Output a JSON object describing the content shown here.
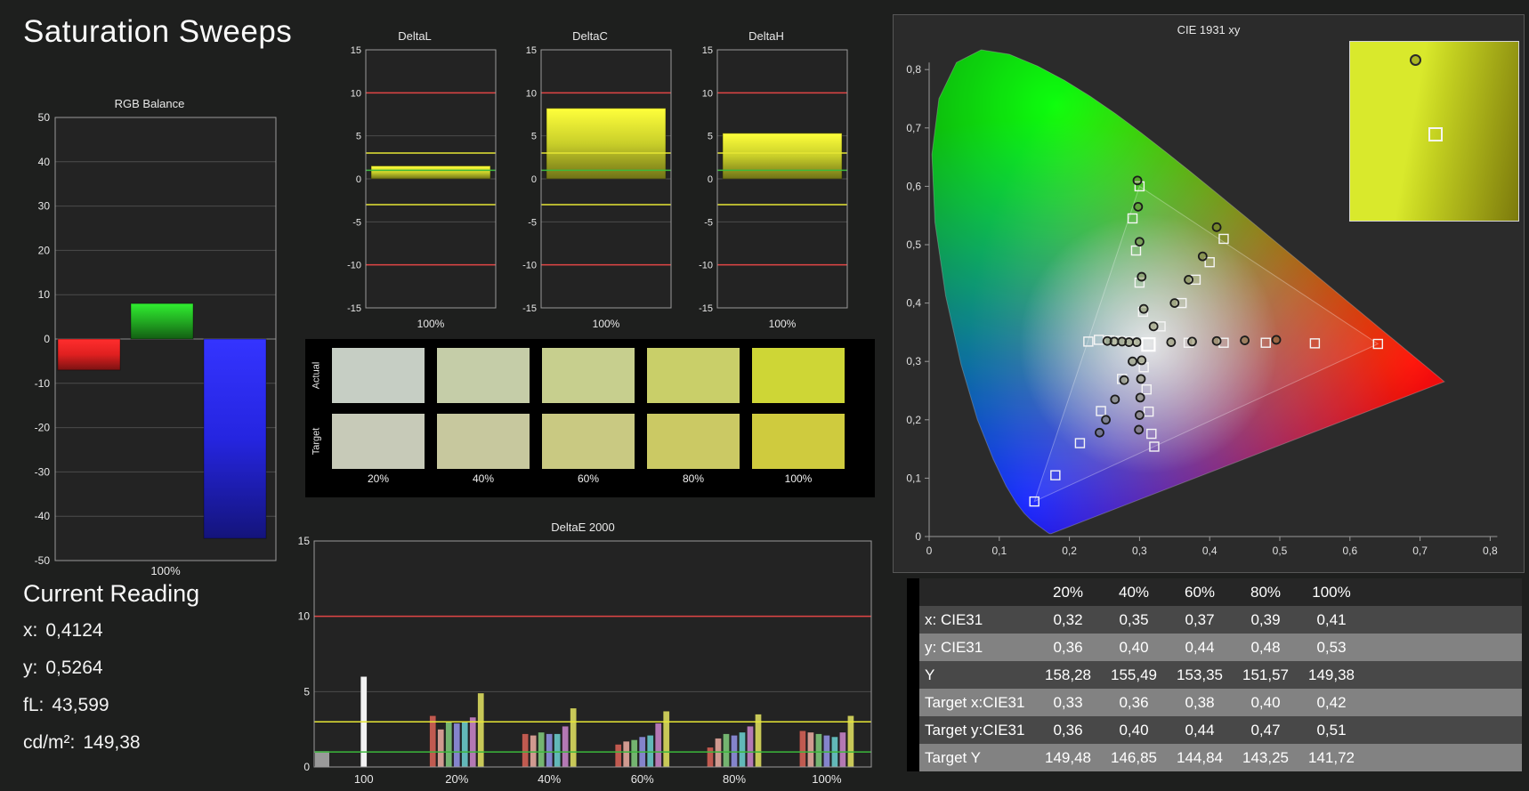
{
  "title": "Saturation Sweeps",
  "current_reading": {
    "heading": "Current Reading",
    "lines": [
      {
        "label": "x:",
        "value": "0,4124"
      },
      {
        "label": "y:",
        "value": "0,5264"
      },
      {
        "label": "fL:",
        "value": "43,599"
      },
      {
        "label": "cd/m²:",
        "value": "149,38"
      }
    ]
  },
  "chart_data": [
    {
      "id": "rgb-balance",
      "type": "bar",
      "title": "RGB Balance",
      "categories": [
        "Red",
        "Green",
        "Blue"
      ],
      "values": [
        -7,
        8,
        -45
      ],
      "bar_colors": [
        "#e02020",
        "#22aa22",
        "#2525e0"
      ],
      "ylim": [
        -50,
        50
      ],
      "ytick_step": 10,
      "xlabel": "100%"
    },
    {
      "id": "delta-l",
      "type": "bar",
      "title": "DeltaL",
      "categories": [
        "100%"
      ],
      "values": [
        1.5
      ],
      "bar_color": "#c9cf2a",
      "ylim": [
        -15,
        15
      ],
      "ytick_step": 5,
      "xlabel": "100%",
      "ref_lines": [
        {
          "y": 10,
          "color": "#e04545"
        },
        {
          "y": -10,
          "color": "#e04545"
        },
        {
          "y": 3,
          "color": "#e6e635"
        },
        {
          "y": -3,
          "color": "#e6e635"
        },
        {
          "y": 1,
          "color": "#3cb83c"
        }
      ]
    },
    {
      "id": "delta-c",
      "type": "bar",
      "title": "DeltaC",
      "categories": [
        "100%"
      ],
      "values": [
        8.2
      ],
      "bar_color": "#c9cf2a",
      "ylim": [
        -15,
        15
      ],
      "ytick_step": 5,
      "xlabel": "100%",
      "ref_lines": [
        {
          "y": 10,
          "color": "#e04545"
        },
        {
          "y": -10,
          "color": "#e04545"
        },
        {
          "y": 3,
          "color": "#e6e635"
        },
        {
          "y": -3,
          "color": "#e6e635"
        },
        {
          "y": 1,
          "color": "#3cb83c"
        }
      ]
    },
    {
      "id": "delta-h",
      "type": "bar",
      "title": "DeltaH",
      "categories": [
        "100%"
      ],
      "values": [
        5.3
      ],
      "bar_color": "#c9cf2a",
      "ylim": [
        -15,
        15
      ],
      "ytick_step": 5,
      "xlabel": "100%",
      "ref_lines": [
        {
          "y": 10,
          "color": "#e04545"
        },
        {
          "y": -10,
          "color": "#e04545"
        },
        {
          "y": 3,
          "color": "#e6e635"
        },
        {
          "y": -3,
          "color": "#e6e635"
        },
        {
          "y": 1,
          "color": "#3cb83c"
        }
      ]
    },
    {
      "id": "delta-e-2000",
      "type": "grouped-bar",
      "title": "DeltaE 2000",
      "ylim": [
        0,
        15
      ],
      "ytick_step": 5,
      "ref_lines": [
        {
          "y": 10,
          "color": "#e04545"
        },
        {
          "y": 3,
          "color": "#e6e635"
        },
        {
          "y": 1,
          "color": "#3cb83c"
        }
      ],
      "edge_bar": {
        "value": 1.05,
        "color": "#9a9a9a"
      },
      "groups": [
        {
          "label": "100",
          "values": [
            6.0
          ],
          "colors": [
            "#f2f2f2"
          ]
        },
        {
          "label": "20%",
          "values": [
            3.4,
            2.5,
            3.0,
            2.9,
            3.0,
            3.3,
            4.9
          ],
          "colors": [
            "#c05a50",
            "#d09a90",
            "#74b470",
            "#8484cc",
            "#62b8b8",
            "#b478b4",
            "#c8c858"
          ]
        },
        {
          "label": "40%",
          "values": [
            2.2,
            2.1,
            2.3,
            2.2,
            2.2,
            2.7,
            3.9
          ],
          "colors": [
            "#c05a50",
            "#d09a90",
            "#74b470",
            "#8484cc",
            "#62b8b8",
            "#b478b4",
            "#c8c858"
          ]
        },
        {
          "label": "60%",
          "values": [
            1.5,
            1.7,
            1.8,
            2.0,
            2.1,
            2.9,
            3.7
          ],
          "colors": [
            "#c05a50",
            "#d09a90",
            "#74b470",
            "#8484cc",
            "#62b8b8",
            "#b478b4",
            "#c8c858"
          ]
        },
        {
          "label": "80%",
          "values": [
            1.3,
            1.9,
            2.2,
            2.1,
            2.3,
            2.7,
            3.5
          ],
          "colors": [
            "#c05a50",
            "#d09a90",
            "#74b470",
            "#8484cc",
            "#62b8b8",
            "#b478b4",
            "#c8c858"
          ]
        },
        {
          "label": "100%",
          "values": [
            2.4,
            2.3,
            2.2,
            2.1,
            2.0,
            2.3,
            3.4
          ],
          "colors": [
            "#c05a50",
            "#d09a90",
            "#74b470",
            "#8484cc",
            "#62b8b8",
            "#b478b4",
            "#c8c858"
          ]
        }
      ]
    },
    {
      "id": "cie-1931",
      "type": "scatter",
      "title": "CIE 1931 xy",
      "xlim": [
        0,
        0.8
      ],
      "ylim": [
        0,
        0.8
      ],
      "xtick_labels": [
        "0",
        "0,1",
        "0,2",
        "0,3",
        "0,4",
        "0,5",
        "0,6",
        "0,7",
        "0,8"
      ],
      "ytick_labels": [
        "0",
        "0,1",
        "0,2",
        "0,3",
        "0,4",
        "0,5",
        "0,6",
        "0,7",
        "0,8"
      ],
      "white_point": [
        0.3127,
        0.329
      ],
      "gamut_triangle": [
        [
          0.64,
          0.33
        ],
        [
          0.3,
          0.6
        ],
        [
          0.15,
          0.06
        ]
      ],
      "target_points": [
        [
          0.37,
          0.332
        ],
        [
          0.42,
          0.332
        ],
        [
          0.48,
          0.332
        ],
        [
          0.55,
          0.331
        ],
        [
          0.64,
          0.33
        ],
        [
          0.305,
          0.385
        ],
        [
          0.3,
          0.435
        ],
        [
          0.295,
          0.49
        ],
        [
          0.29,
          0.545
        ],
        [
          0.3,
          0.6
        ],
        [
          0.33,
          0.36
        ],
        [
          0.36,
          0.4
        ],
        [
          0.38,
          0.44
        ],
        [
          0.4,
          0.47
        ],
        [
          0.42,
          0.51
        ],
        [
          0.275,
          0.27
        ],
        [
          0.245,
          0.215
        ],
        [
          0.215,
          0.16
        ],
        [
          0.18,
          0.105
        ],
        [
          0.15,
          0.06
        ],
        [
          0.287,
          0.334
        ],
        [
          0.272,
          0.335
        ],
        [
          0.257,
          0.336
        ],
        [
          0.242,
          0.337
        ],
        [
          0.227,
          0.334
        ],
        [
          0.306,
          0.29
        ],
        [
          0.31,
          0.252
        ],
        [
          0.313,
          0.214
        ],
        [
          0.317,
          0.176
        ],
        [
          0.321,
          0.154
        ]
      ],
      "measured_points": [
        [
          0.32,
          0.36
        ],
        [
          0.35,
          0.4
        ],
        [
          0.37,
          0.44
        ],
        [
          0.39,
          0.48
        ],
        [
          0.41,
          0.53
        ],
        [
          0.306,
          0.39
        ],
        [
          0.303,
          0.445
        ],
        [
          0.3,
          0.505
        ],
        [
          0.298,
          0.565
        ],
        [
          0.297,
          0.61
        ],
        [
          0.345,
          0.333
        ],
        [
          0.375,
          0.334
        ],
        [
          0.41,
          0.335
        ],
        [
          0.45,
          0.336
        ],
        [
          0.495,
          0.337
        ],
        [
          0.29,
          0.3
        ],
        [
          0.278,
          0.268
        ],
        [
          0.265,
          0.235
        ],
        [
          0.252,
          0.2
        ],
        [
          0.243,
          0.178
        ],
        [
          0.296,
          0.333
        ],
        [
          0.285,
          0.333
        ],
        [
          0.275,
          0.334
        ],
        [
          0.264,
          0.334
        ],
        [
          0.254,
          0.335
        ],
        [
          0.303,
          0.302
        ],
        [
          0.302,
          0.27
        ],
        [
          0.301,
          0.238
        ],
        [
          0.3,
          0.208
        ],
        [
          0.299,
          0.183
        ]
      ]
    }
  ],
  "cie_inset": {
    "colors": [
      "#d9e92c",
      "#c3d020",
      "#7c7a0c"
    ],
    "circle": [
      0.38,
      0.1
    ],
    "square": [
      0.5,
      0.51
    ]
  },
  "swatches": {
    "row_labels": [
      "Actual",
      "Target"
    ],
    "col_labels": [
      "20%",
      "40%",
      "60%",
      "80%",
      "100%"
    ],
    "rows": [
      {
        "name": "Actual",
        "colors": [
          "#c6cec4",
          "#c5cda8",
          "#c7cf8e",
          "#c9cf69",
          "#ced636"
        ]
      },
      {
        "name": "Target",
        "colors": [
          "#c7cab8",
          "#c7c89e",
          "#c9c982",
          "#cbc964",
          "#cfcb3e"
        ]
      }
    ]
  },
  "table": {
    "col_headers": [
      "20%",
      "40%",
      "60%",
      "80%",
      "100%"
    ],
    "rows": [
      {
        "label": "x: CIE31",
        "values": [
          "0,32",
          "0,35",
          "0,37",
          "0,39",
          "0,41"
        ]
      },
      {
        "label": "y: CIE31",
        "values": [
          "0,36",
          "0,40",
          "0,44",
          "0,48",
          "0,53"
        ]
      },
      {
        "label": "Y",
        "values": [
          "158,28",
          "155,49",
          "153,35",
          "151,57",
          "149,38"
        ]
      },
      {
        "label": "Target x:CIE31",
        "values": [
          "0,33",
          "0,36",
          "0,38",
          "0,40",
          "0,42"
        ]
      },
      {
        "label": "Target y:CIE31",
        "values": [
          "0,36",
          "0,40",
          "0,44",
          "0,47",
          "0,51"
        ]
      },
      {
        "label": "Target Y",
        "values": [
          "149,48",
          "146,85",
          "144,84",
          "143,25",
          "141,72"
        ]
      }
    ]
  }
}
